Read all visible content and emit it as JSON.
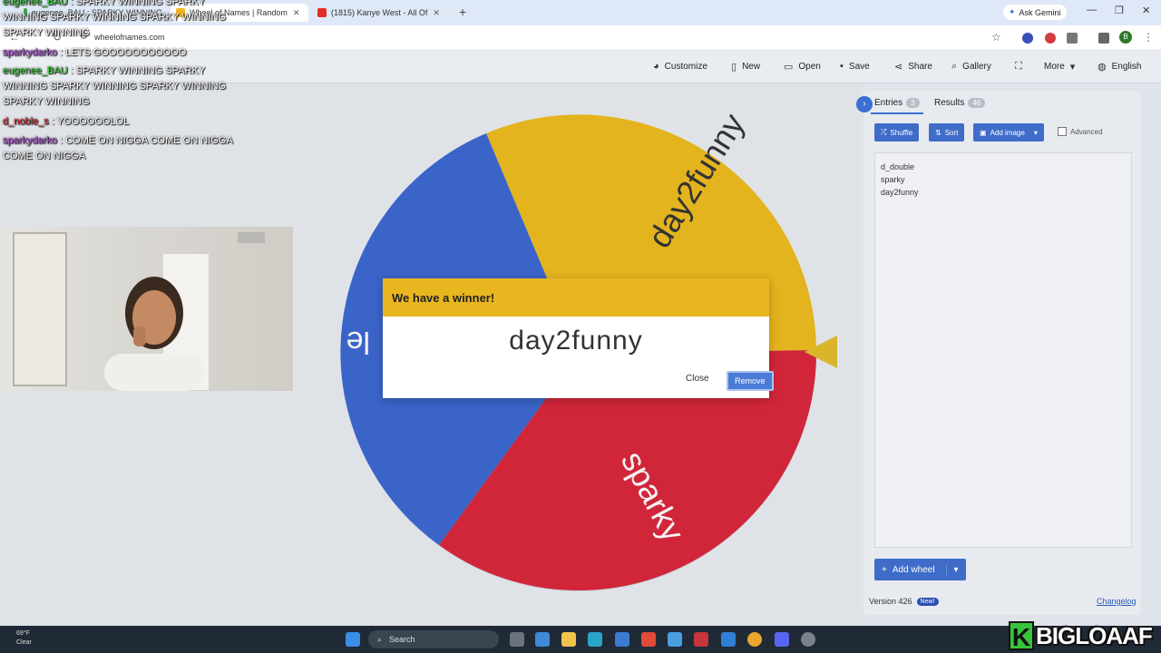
{
  "browser": {
    "tabs": [
      {
        "label": "eugenee_BAU : SPARKY WINNING",
        "color": "#3fa34d"
      },
      {
        "label": "Wheel of Names | Random",
        "color": "#f3b81f"
      },
      {
        "label": "(1815) Kanye West - All Of",
        "color": "#e52d27"
      }
    ],
    "new_tab": "+",
    "ask_gemini": "Ask Gemini",
    "url": "wheelofnames.com",
    "profile_initial": "B"
  },
  "toolbar": {
    "customize": "Customize",
    "new": "New",
    "open": "Open",
    "save": "Save",
    "share": "Share",
    "gallery": "Gallery",
    "more": "More",
    "language": "English"
  },
  "wheel": {
    "segments": [
      {
        "label": "day2funny",
        "color": "#e4b41e"
      },
      {
        "label": "sparky",
        "color": "#d1263a"
      },
      {
        "label": "d_double",
        "color": "#3a64c8"
      }
    ],
    "partial_label": "le"
  },
  "modal": {
    "title": "We have a winner!",
    "winner": "day2funny",
    "close_label": "Close",
    "remove_label": "Remove"
  },
  "panel": {
    "entries_tab": "Entries",
    "entries_count": "3",
    "results_tab": "Results",
    "results_count": "46",
    "shuffle": "Shuffle",
    "sort": "Sort",
    "add_image": "Add image",
    "advanced": "Advanced",
    "entries": [
      "d_double",
      "sparky",
      "day2funny"
    ],
    "add_wheel": "Add wheel",
    "version": "Version 426",
    "new_badge": "New!",
    "changelog": "Changelog"
  },
  "chat": [
    {
      "user": "eugenee_BAU",
      "msg": ": SPARKY WINNING SPARKY WINNING SPARKY WINNING SPARKY WINNING SPARKY WINNING",
      "user_color": "#3fd13f"
    },
    {
      "user": "sparkydarko",
      "msg": ": LETS GOOOOOOOOOOO",
      "user_color": "#b04fd8"
    },
    {
      "user": "eugenee_BAU",
      "msg": ": SPARKY WINNING SPARKY WINNING SPARKY WINNING SPARKY WINNING SPARKY WINNING",
      "user_color": "#3fd13f"
    },
    {
      "user": "d_noble_s",
      "msg": ": YOOOOOOLOL",
      "user_color": "#e03131"
    },
    {
      "user": "sparkydarko",
      "msg": ": COME ON NIGGA COME ON NIGGA COME ON NIGGA",
      "user_color": "#b04fd8"
    }
  ],
  "taskbar": {
    "temp": "69°F",
    "condition": "Clear",
    "search": "Search"
  },
  "stream_brand": {
    "initial": "K",
    "name": "BIGLOAAF"
  }
}
